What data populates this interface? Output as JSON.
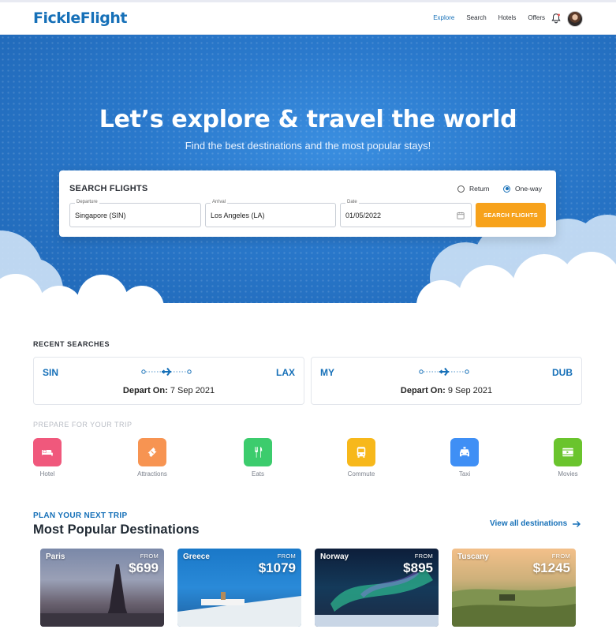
{
  "brand": {
    "logo": "FickleFlight"
  },
  "nav": {
    "links": [
      "Explore",
      "Search",
      "Hotels",
      "Offers"
    ],
    "active": "Explore",
    "bell_icon": "bell-icon",
    "avatar": "user-avatar"
  },
  "hero": {
    "title": "Let’s explore & travel the world",
    "subtitle": "Find the best destinations and the most popular stays!"
  },
  "search": {
    "title": "SEARCH FLIGHTS",
    "trip_types": [
      {
        "label": "Return",
        "selected": false
      },
      {
        "label": "One-way",
        "selected": true
      }
    ],
    "departure": {
      "label": "Departure",
      "value": "Singapore (SIN)"
    },
    "arrival": {
      "label": "Arrival",
      "value": "Los Angeles (LA)"
    },
    "date": {
      "label": "Date",
      "value": "01/05/2022"
    },
    "button": "SEARCH FLIGHTS"
  },
  "recent": {
    "title": "RECENT SEARCHES",
    "items": [
      {
        "from": "SIN",
        "to": "LAX",
        "depart_label": "Depart On:",
        "depart_date": "7 Sep 2021"
      },
      {
        "from": "MY",
        "to": "DUB",
        "depart_label": "Depart On:",
        "depart_date": "9 Sep 2021"
      }
    ]
  },
  "prepare": {
    "title": "PREPARE FOR YOUR TRIP",
    "items": [
      {
        "label": "Hotel",
        "icon": "bed-icon",
        "color": "#f0587c"
      },
      {
        "label": "Attractions",
        "icon": "ticket-icon",
        "color": "#f79452"
      },
      {
        "label": "Eats",
        "icon": "cutlery-icon",
        "color": "#3ccc6d"
      },
      {
        "label": "Commute",
        "icon": "bus-icon",
        "color": "#f7b81b"
      },
      {
        "label": "Taxi",
        "icon": "taxi-icon",
        "color": "#3f8ff5"
      },
      {
        "label": "Movies",
        "icon": "film-icon",
        "color": "#6ac42d"
      }
    ]
  },
  "destinations": {
    "kicker": "PLAN YOUR NEXT TRIP",
    "title": "Most Popular Destinations",
    "view_all": "View all destinations",
    "items": [
      {
        "name": "Paris",
        "from": "FROM",
        "price": "$699"
      },
      {
        "name": "Greece",
        "from": "FROM",
        "price": "$1079"
      },
      {
        "name": "Norway",
        "from": "FROM",
        "price": "$895"
      },
      {
        "name": "Tuscany",
        "from": "FROM",
        "price": "$1245"
      }
    ]
  }
}
